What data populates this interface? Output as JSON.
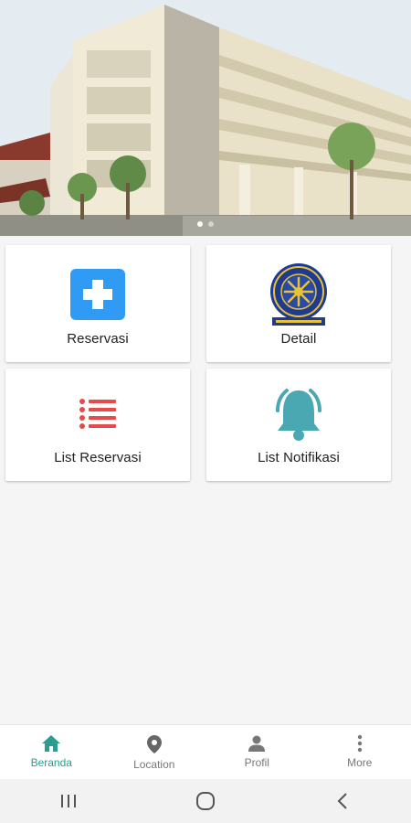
{
  "banner": {
    "image": "university-building-photo",
    "slides": 2,
    "active_slide": 1
  },
  "menu": {
    "reservasi": {
      "label": "Reservasi",
      "icon": "medical-cross-icon",
      "color": "#2f9bf5"
    },
    "detail": {
      "label": "Detail",
      "icon": "university-logo-icon"
    },
    "list_reservasi": {
      "label": "List Reservasi",
      "icon": "list-icon",
      "color": "#e64a4a"
    },
    "list_notifikasi": {
      "label": "List Notifikasi",
      "icon": "bell-ringing-icon",
      "color": "#4aa8b3"
    }
  },
  "bottom_nav": {
    "items": [
      {
        "label": "Beranda",
        "icon": "home-icon",
        "active": true
      },
      {
        "label": "Location",
        "icon": "location-pin-icon",
        "active": false
      },
      {
        "label": "Profil",
        "icon": "person-icon",
        "active": false
      },
      {
        "label": "More",
        "icon": "more-vertical-icon",
        "active": false
      }
    ],
    "active_color": "#2a9d8f"
  },
  "system_nav": {
    "buttons": [
      "recents-icon",
      "home-circle-icon",
      "back-icon"
    ]
  }
}
